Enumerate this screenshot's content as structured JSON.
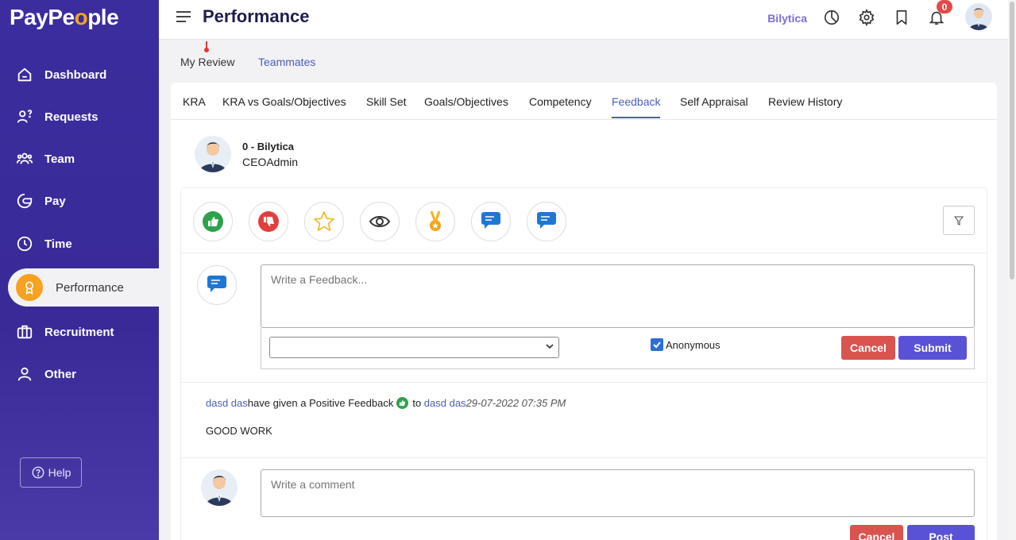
{
  "app": {
    "logo": "PayPe",
    "logo_o": "o",
    "logo_end": "ple"
  },
  "sidebar": {
    "items": [
      {
        "label": "Dashboard"
      },
      {
        "label": "Requests"
      },
      {
        "label": "Team"
      },
      {
        "label": "Pay"
      },
      {
        "label": "Time"
      },
      {
        "label": "Performance"
      },
      {
        "label": "Recruitment"
      },
      {
        "label": "Other"
      }
    ],
    "help_label": "Help"
  },
  "header": {
    "title": "Performance",
    "company": "Bilytica",
    "notification_count": "0"
  },
  "review_tabs": {
    "my_review": "My Review",
    "teammates": "Teammates"
  },
  "subtabs": [
    "KRA",
    "KRA vs Goals/Objectives",
    "Skill Set",
    "Goals/Objectives",
    "Competency",
    "Feedback",
    "Self Appraisal",
    "Review History"
  ],
  "profile": {
    "name": "0 - Bilytica",
    "role": "CEOAdmin"
  },
  "compose": {
    "placeholder": "Write a Feedback...",
    "select_value": "",
    "anonymous_label": "Anonymous",
    "anonymous_checked": true,
    "cancel_label": "Cancel",
    "submit_label": "Submit"
  },
  "feedback_entry": {
    "from": "dasd das",
    "action": "have given a Positive Feedback",
    "to_word": "to",
    "to": "dasd das",
    "time": "29-07-2022 07:35 PM",
    "text": "GOOD WORK"
  },
  "comment": {
    "placeholder": "Write a comment",
    "cancel_label": "Cancel",
    "post_label": "Post"
  },
  "colors": {
    "sidebar": "#3b2d9e",
    "accent": "#4a5fb8",
    "primary_button": "#5a52d6",
    "danger": "#d9534f",
    "orange": "#f6a21e"
  }
}
